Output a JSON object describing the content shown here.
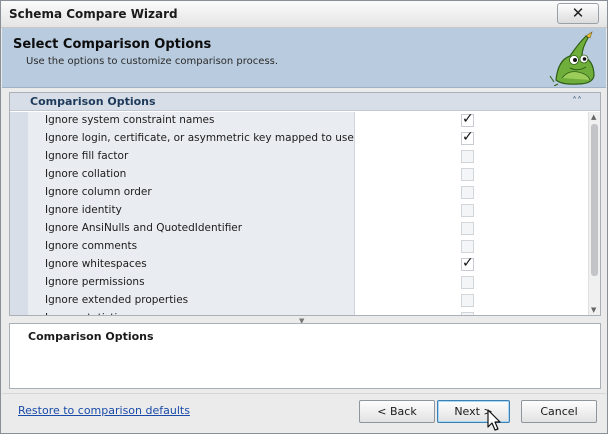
{
  "window": {
    "title": "Schema Compare Wizard",
    "close_label": "✕"
  },
  "banner": {
    "title": "Select Comparison Options",
    "subtitle": "Use the options to customize comparison process."
  },
  "grid": {
    "header": "Comparison Options",
    "options": [
      {
        "label": "Ignore system constraint names",
        "checked": true
      },
      {
        "label": "Ignore login, certificate, or asymmetric key mapped to user",
        "checked": true
      },
      {
        "label": "Ignore fill factor",
        "checked": false
      },
      {
        "label": "Ignore collation",
        "checked": false
      },
      {
        "label": "Ignore column order",
        "checked": false
      },
      {
        "label": "Ignore identity",
        "checked": false
      },
      {
        "label": "Ignore AnsiNulls and QuotedIdentifier",
        "checked": false
      },
      {
        "label": "Ignore comments",
        "checked": false
      },
      {
        "label": "Ignore whitespaces",
        "checked": true
      },
      {
        "label": "Ignore permissions",
        "checked": false
      },
      {
        "label": "Ignore extended properties",
        "checked": false
      },
      {
        "label": "Ignore statistics",
        "checked": false
      }
    ]
  },
  "description": {
    "title": "Comparison Options"
  },
  "footer": {
    "restore_link": "Restore to comparison defaults",
    "back_label": "< Back",
    "next_label": "Next >",
    "cancel_label": "Cancel"
  }
}
